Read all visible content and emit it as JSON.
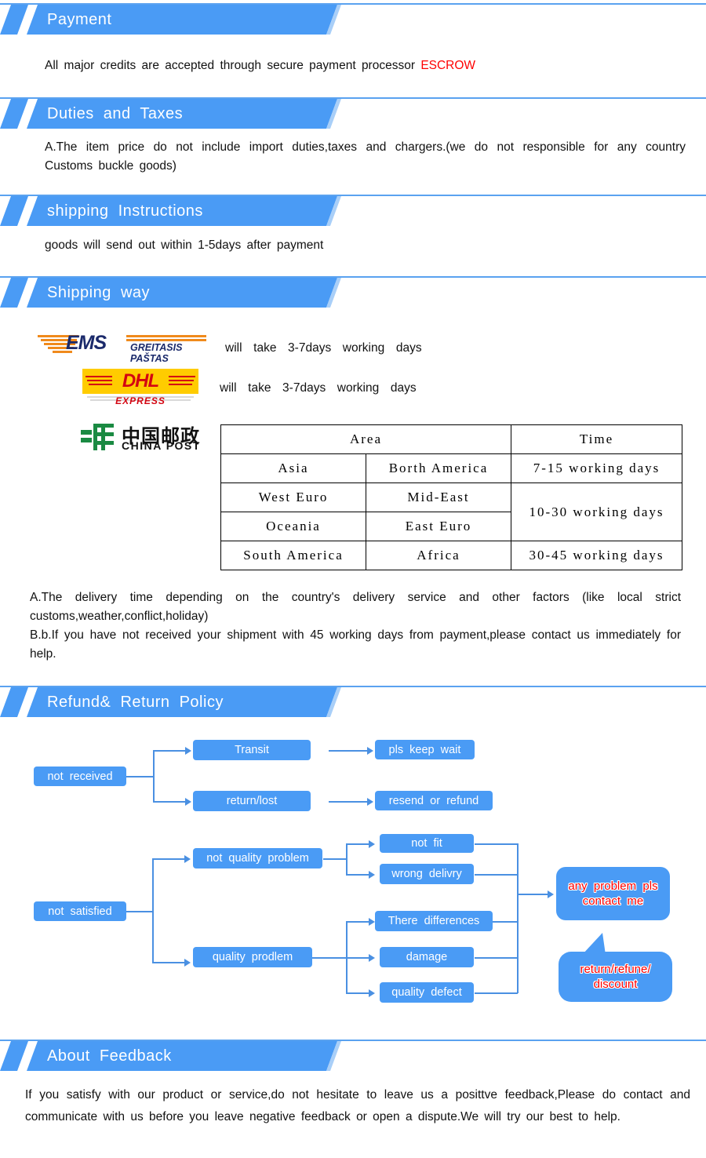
{
  "sections": [
    {
      "id": "payment",
      "title": "Payment"
    },
    {
      "id": "duties",
      "title": "Duties  and  Taxes"
    },
    {
      "id": "shipinstr",
      "title": "shipping  Instructions"
    },
    {
      "id": "shipway",
      "title": "Shipping  way"
    },
    {
      "id": "refund",
      "title": "Refund&  Return  Policy"
    },
    {
      "id": "feedback",
      "title": "About  Feedback"
    }
  ],
  "payment": {
    "text_before": "All  major  credits  are  accepted  through  secure  payment  processor  ",
    "escrow": "ESCROW"
  },
  "duties": {
    "text": "A.The  item  price  do  not  include  import  duties,taxes  and  chargers.(we  do  not  responsible  for  any  country  Customs  buckle  goods)"
  },
  "shipping_instructions": {
    "text": "goods  will  send  out  within  1-5days  after  payment"
  },
  "shipping_way": {
    "carriers": [
      {
        "logo": "ems-logo",
        "name": "EMS GREITASIS PAŠTAS",
        "text": "will  take  3-7days  working  days"
      },
      {
        "logo": "dhl-logo",
        "name": "DHL EXPRESS",
        "text": "will  take  3-7days  working  days"
      },
      {
        "logo": "china-post-logo",
        "name": "CHINA POST",
        "text": ""
      }
    ],
    "ems": {
      "word": "EMS",
      "sub": "GREITASIS PAŠTAS"
    },
    "dhl": {
      "word": "DHL",
      "sub": "EXPRESS"
    },
    "china_post": {
      "cn": "中国邮政",
      "en": "CHINA POST"
    },
    "table": {
      "headers": [
        "Area",
        "Time"
      ],
      "rows": [
        {
          "area1": "Asia",
          "area2": "Borth America",
          "time": "7-15 working days"
        },
        {
          "area1": "West Euro",
          "area2": "Mid-East",
          "time": "10-30 working days"
        },
        {
          "area1": "Oceania",
          "area2": "East Euro",
          "time": ""
        },
        {
          "area1": "South America",
          "area2": "Africa",
          "time": "30-45 working days"
        }
      ]
    },
    "note_a": "A.The  delivery  time  depending  on  the  country's  delivery  service  and  other  factors  (like  local  strict  customs,weather,conflict,holiday)",
    "note_b": "B.b.If  you  have  not  received  your  shipment  with  45  working  days  from  payment,please  contact  us  immediately  for  help."
  },
  "refund_flow": {
    "nodes": {
      "not_received": "not  received",
      "transit": "Transit",
      "return_lost": "return/lost",
      "pls_keep_wait": "pls  keep  wait",
      "resend_or_refund": "resend  or  refund",
      "not_satisfied": "not  satisfied",
      "not_quality_problem": "not  quality  problem",
      "quality_prodlem": "quality  prodlem",
      "not_fit": "not  fit",
      "wrong_delivry": "wrong  delivry",
      "there_differences": "There  differences",
      "damage": "damage",
      "quality_defect": "quality  defect",
      "contact_me": "any  problem  pls\ncontact  me",
      "return_refune": "return/refune/\ndiscount"
    }
  },
  "feedback": {
    "text": "If  you  satisfy  with  our  product  or  service,do  not  hesitate  to  leave  us  a  posittve  feedback,Please  do  contact  and  communicate  with  us  before  you  leave  negative  feedback  or  open  a  dispute.We  will  try  our  best  to  help."
  },
  "colors": {
    "banner_blue": "#4a9bf5",
    "rule_blue": "#5aa2f0",
    "box_blue": "#4a9bf5",
    "line_blue": "#4a90e2",
    "escrow_red": "#ff0000",
    "ems_navy": "#1b2a6b",
    "ems_orange": "#f08a1c",
    "dhl_yellow": "#ffcc00",
    "dhl_red": "#d40511",
    "china_post_green": "#1a8a42"
  }
}
